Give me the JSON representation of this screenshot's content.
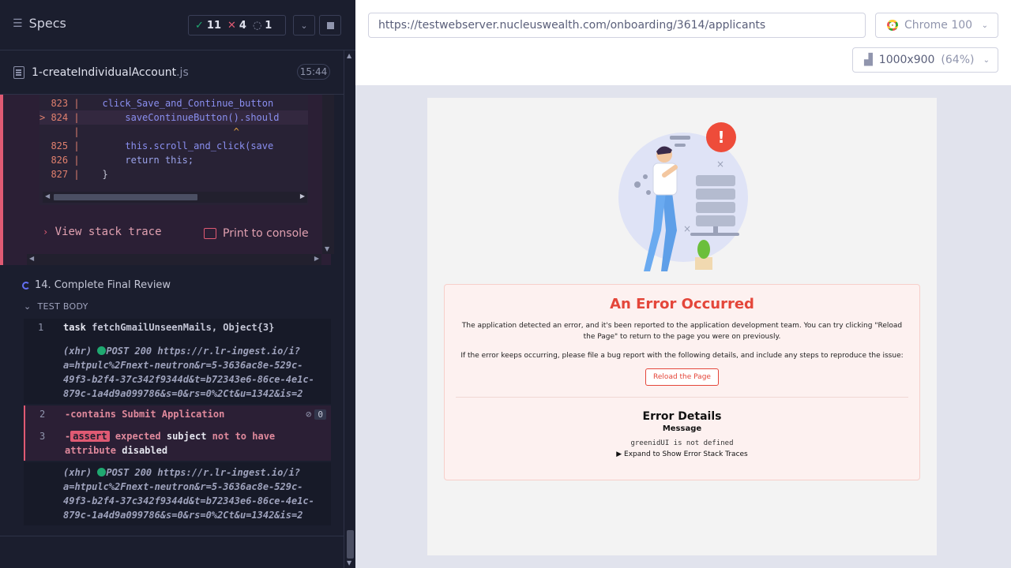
{
  "runner": {
    "specs_label": "Specs",
    "passed": "11",
    "failed": "4",
    "pending": "1",
    "file_name": "1-createIndividualAccount",
    "file_ext": ".js",
    "duration": "15:44"
  },
  "code": {
    "lines": [
      {
        "num": "823",
        "marker": " ",
        "text": "    click_Save_and_Continue_button"
      },
      {
        "num": "824",
        "marker": ">",
        "text": "        saveContinueButton().should"
      },
      {
        "num": "",
        "marker": " ",
        "text": "                           ^"
      },
      {
        "num": "825",
        "marker": " ",
        "text": "        this.scroll_and_click(save"
      },
      {
        "num": "826",
        "marker": " ",
        "text": "        return this;"
      },
      {
        "num": "827",
        "marker": " ",
        "text": "    }"
      }
    ],
    "view_stack_trace": "View stack trace",
    "print_to_console": "Print to console"
  },
  "test": {
    "title": "14. Complete Final Review",
    "body_label": "TEST BODY",
    "commands": {
      "c1_num": "1",
      "c1_name": "task",
      "c1_args": "fetchGmailUnseenMails, Object{3}",
      "xhr1_label": "(xhr)",
      "xhr1_line1": "POST 200 https://r.lr-ingest.io/i?",
      "xhr1_line2": "a=htpulc%2Fnext-neutron&r=5-3636ac8e-529c-",
      "xhr1_line3": "49f3-b2f4-37c342f9344d&t=b72343e6-86ce-4e1c-",
      "xhr1_line4": "879c-1a4d9a099786&s=0&rs=0%2Ct&u=1342&is=2",
      "c2_num": "2",
      "c2_name": "-contains",
      "c2_args": "Submit Application",
      "c2_count": "0",
      "c3_num": "3",
      "c3_dash": "-",
      "c3_name": "assert",
      "c3_w1": "expected",
      "c3_w2": "subject",
      "c3_w3": "not to have",
      "c3_w4": "attribute",
      "c3_w5": "disabled",
      "xhr2_label": "(xhr)",
      "xhr2_line1": "POST 200 https://r.lr-ingest.io/i?",
      "xhr2_line2": "a=htpulc%2Fnext-neutron&r=5-3636ac8e-529c-",
      "xhr2_line3": "49f3-b2f4-37c342f9344d&t=b72343e6-86ce-4e1c-",
      "xhr2_line4": "879c-1a4d9a099786&s=0&rs=0%2Ct&u=1342&is=2"
    }
  },
  "browser": {
    "url": "https://testwebserver.nucleuswealth.com/onboarding/3614/applicants",
    "name": "Chrome 100",
    "viewport": "1000x900",
    "zoom": "(64%)"
  },
  "app": {
    "error_title": "An Error Occurred",
    "error_msg1": "The application detected an error, and it's been reported to the application development team. You can try clicking \"Reload the Page\" to return to the page you were on previously.",
    "error_msg2": "If the error keeps occurring, please file a bug report with the following details, and include any steps to reproduce the issue:",
    "reload_label": "Reload the Page",
    "details_title": "Error Details",
    "message_label": "Message",
    "message_value": "greenidUI is not defined",
    "expand_label": "Expand to Show Error Stack Traces",
    "error_badge": "!"
  },
  "colors": {
    "pass": "#1fa971",
    "fail": "#e05a73",
    "accent_error": "#e4463a"
  }
}
